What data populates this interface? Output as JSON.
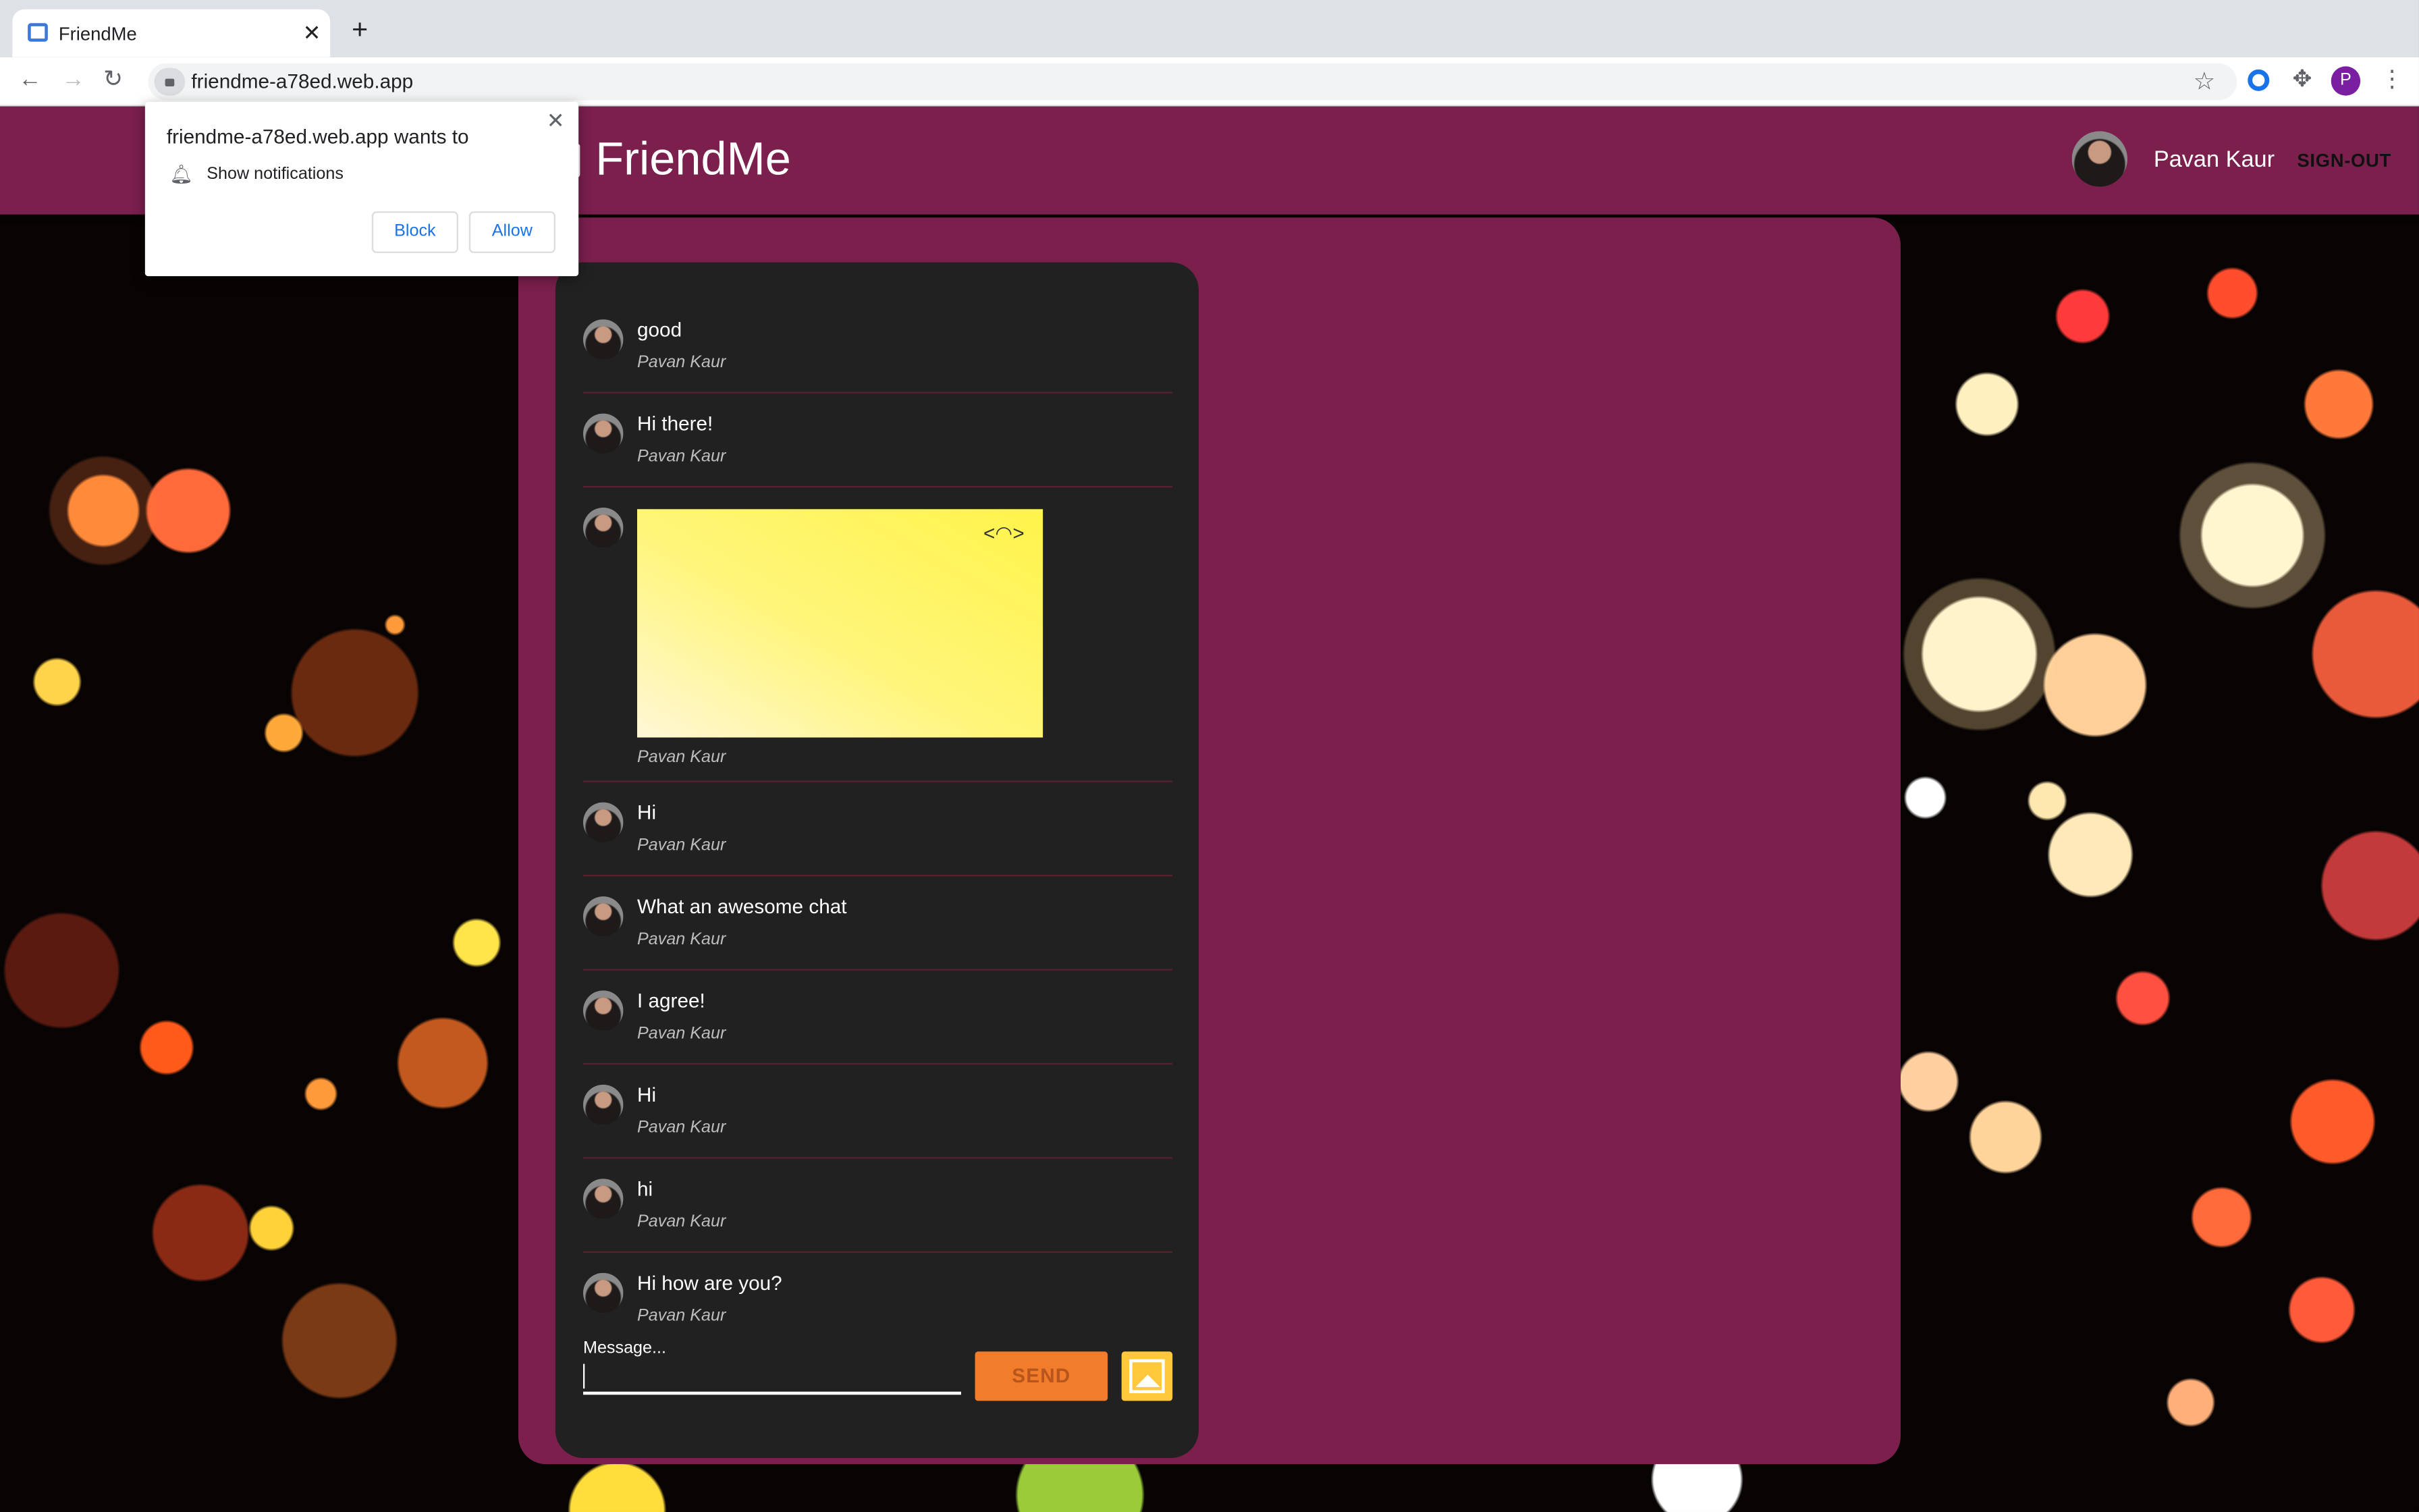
{
  "browser": {
    "tab_title": "FriendMe",
    "url": "friendme-a78ed.web.app",
    "profile_initial": "P"
  },
  "popup": {
    "title": "friendme-a78ed.web.app wants to",
    "permission": "Show notifications",
    "block_label": "Block",
    "allow_label": "Allow"
  },
  "header": {
    "brand": "FriendMe",
    "user_name": "Pavan Kaur",
    "signout_label": "SIGN-OUT"
  },
  "messages": [
    {
      "text": "good",
      "author": "Pavan Kaur"
    },
    {
      "text": "Hi there!",
      "author": "Pavan Kaur"
    },
    {
      "text": "",
      "author": "Pavan Kaur",
      "image": true
    },
    {
      "text": "Hi",
      "author": "Pavan Kaur"
    },
    {
      "text": "What an awesome chat",
      "author": "Pavan Kaur"
    },
    {
      "text": "I agree!",
      "author": "Pavan Kaur"
    },
    {
      "text": "Hi",
      "author": "Pavan Kaur"
    },
    {
      "text": "hi",
      "author": "Pavan Kaur"
    },
    {
      "text": "Hi how are you?",
      "author": "Pavan Kaur"
    }
  ],
  "composer": {
    "label": "Message...",
    "send_label": "SEND"
  },
  "colors": {
    "brand": "#7b1f4d",
    "send": "#f07c2c",
    "image_button": "#ffc83a"
  }
}
